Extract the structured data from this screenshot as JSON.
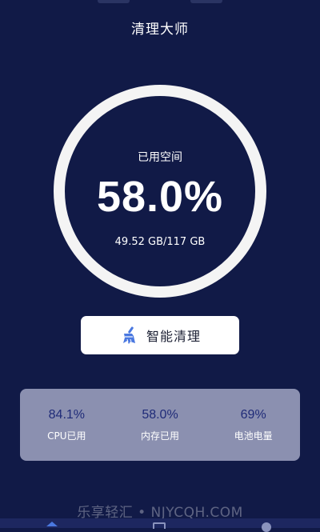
{
  "header": {
    "title": "清理大师"
  },
  "storage": {
    "label": "已用空间",
    "percent": "58.0%",
    "detail": "49.52 GB/117 GB",
    "used_fraction": 0.58
  },
  "clean_button": {
    "label": "智能清理",
    "icon": "broom-icon"
  },
  "stats": [
    {
      "value": "84.1%",
      "label": "CPU已用"
    },
    {
      "value": "58.0%",
      "label": "内存已用"
    },
    {
      "value": "69%",
      "label": "电池电量"
    }
  ],
  "watermark": "乐享轻汇 • NJYCQH.COM",
  "bottom_nav": {
    "items": [
      {
        "icon": "home-icon",
        "active": true
      },
      {
        "icon": "toolbox-icon",
        "active": false
      },
      {
        "icon": "profile-icon",
        "active": false
      }
    ]
  },
  "colors": {
    "background": "#111a47",
    "ring": "#f4f4f4",
    "stats_panel": "#8b90b0",
    "stat_value": "#1f2b78",
    "accent": "#4a78e0"
  }
}
